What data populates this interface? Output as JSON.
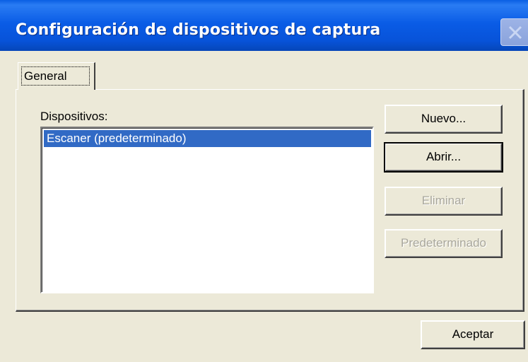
{
  "window": {
    "title": "Configuración de dispositivos de captura"
  },
  "tabs": [
    {
      "label": "General",
      "selected": true
    }
  ],
  "devices": {
    "label": "Dispositivos:",
    "items": [
      {
        "name": "Escaner (predeterminado)",
        "selected": true
      }
    ]
  },
  "buttons": {
    "new": "Nuevo...",
    "open": "Abrir...",
    "delete": "Eliminar",
    "set_default": "Predeterminado",
    "accept": "Aceptar"
  },
  "colors": {
    "title_bar": "#0a5ce6",
    "selection": "#316ac5",
    "dialog_bg": "#ece9d8"
  }
}
